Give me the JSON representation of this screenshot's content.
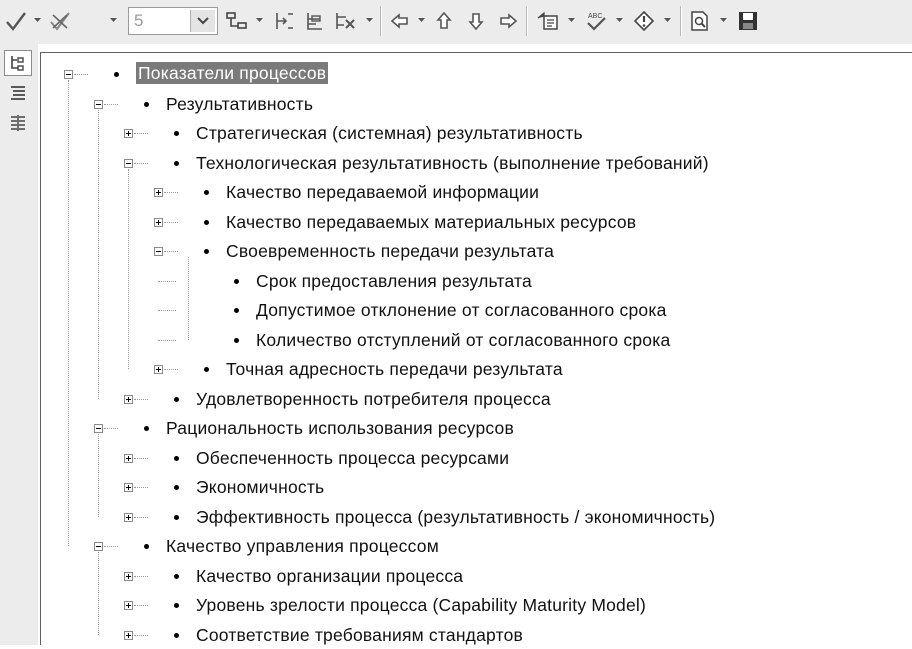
{
  "toolbar": {
    "level_value": "5",
    "icons": [
      "checkmark-icon",
      "uncheck-icon",
      "level-dropdown",
      "tree-view-icon",
      "indent-left-icon",
      "outline-icon",
      "delete-node-icon",
      "move-left-icon",
      "move-up-icon",
      "move-down-icon",
      "move-right-icon",
      "insert-icon",
      "spellcheck-icon",
      "warning-icon",
      "preview-icon",
      "save-icon"
    ]
  },
  "sidebar": {
    "icons": [
      "tree-view-icon",
      "list-view-icon",
      "columns-view-icon"
    ]
  },
  "tree": [
    {
      "label": "Показатели процессов",
      "level": 0,
      "state": "open",
      "selected": true
    },
    {
      "label": "Результативность",
      "level": 1,
      "state": "open"
    },
    {
      "label": "Стратегическая (системная) результативность",
      "level": 2,
      "state": "closed"
    },
    {
      "label": "Технологическая результативность (выполнение требований)",
      "level": 2,
      "state": "open"
    },
    {
      "label": "Качество передаваемой информации",
      "level": 3,
      "state": "closed"
    },
    {
      "label": "Качество передаваемых материальных ресурсов",
      "level": 3,
      "state": "closed"
    },
    {
      "label": "Своевременность передачи результата",
      "level": 3,
      "state": "open"
    },
    {
      "label": "Срок предоставления результата",
      "level": 4,
      "state": "leaf"
    },
    {
      "label": "Допустимое отклонение от согласованного срока",
      "level": 4,
      "state": "leaf"
    },
    {
      "label": "Количество отступлений от согласованного срока",
      "level": 4,
      "state": "leaf"
    },
    {
      "label": "Точная адресность передачи результата",
      "level": 3,
      "state": "closed"
    },
    {
      "label": "Удовлетворенность потребителя процесса",
      "level": 2,
      "state": "closed"
    },
    {
      "label": "Рациональность использования ресурсов",
      "level": 1,
      "state": "open"
    },
    {
      "label": "Обеспеченность процесса ресурсами",
      "level": 2,
      "state": "closed"
    },
    {
      "label": "Экономичность",
      "level": 2,
      "state": "closed"
    },
    {
      "label": "Эффективность процесса (результативность / экономичность)",
      "level": 2,
      "state": "closed"
    },
    {
      "label": "Качество управления процессом",
      "level": 1,
      "state": "open"
    },
    {
      "label": "Качество организации процесса",
      "level": 2,
      "state": "closed"
    },
    {
      "label": "Уровень зрелости процесса (Capability Maturity Model)",
      "level": 2,
      "state": "closed"
    },
    {
      "label": "Соответствие требованиям стандартов",
      "level": 2,
      "state": "closed"
    }
  ]
}
